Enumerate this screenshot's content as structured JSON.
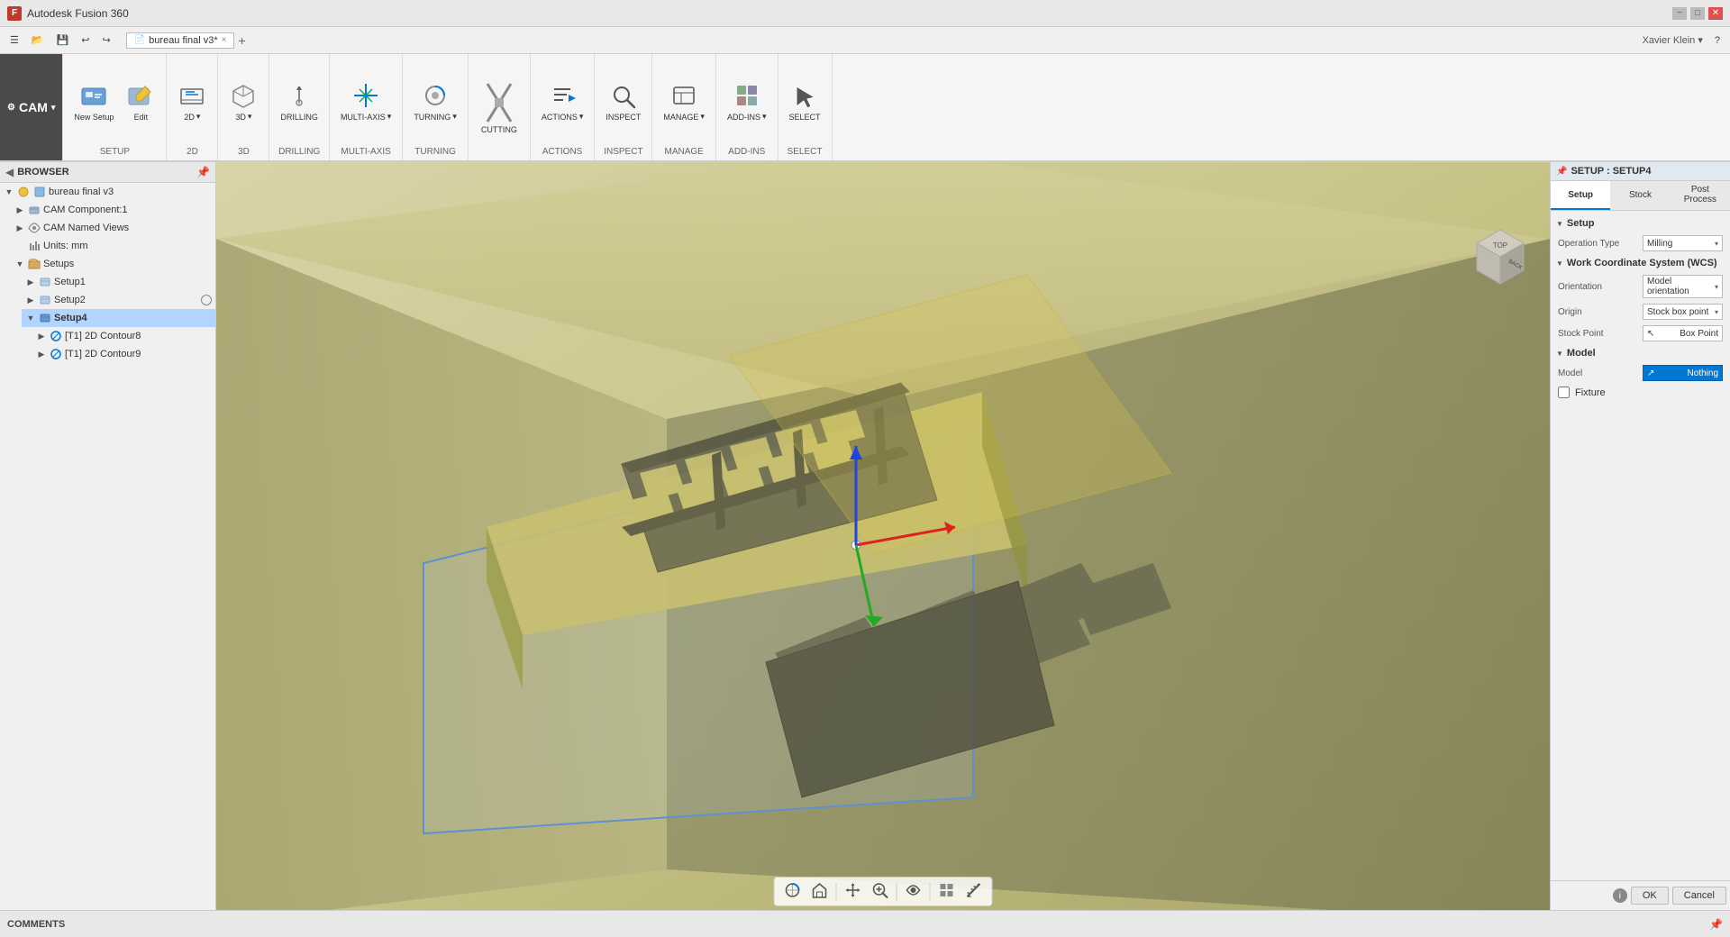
{
  "app": {
    "title": "Autodesk Fusion 360",
    "icon": "F"
  },
  "titlebar": {
    "title": "Autodesk Fusion 360",
    "minimize": "−",
    "maximize": "□",
    "close": "✕"
  },
  "quickaccess": {
    "save_label": "💾",
    "undo_label": "↩",
    "redo_label": "↪",
    "tab_label": "bureau final v3*",
    "tab_close": "×",
    "tab_add": "+"
  },
  "ribbon": {
    "cam_label": "CAM",
    "cam_arrow": "▾",
    "setup_label": "SETUP",
    "setup_arrow": "▾",
    "2d_label": "2D",
    "2d_arrow": "▾",
    "3d_label": "3D",
    "3d_arrow": "▾",
    "drilling_label": "DRILLING",
    "multi_axis_label": "MULTI-AXIS",
    "multi_axis_arrow": "▾",
    "turning_label": "TURNING",
    "turning_arrow": "▾",
    "cutting_label": "CUTTING",
    "actions_label": "ACTIONS",
    "actions_arrow": "▾",
    "inspect_label": "INSPECT",
    "manage_label": "MANAGE",
    "manage_arrow": "▾",
    "addins_label": "ADD-INS",
    "addins_arrow": "▾",
    "select_label": "SELECT"
  },
  "browser": {
    "header": "BROWSER",
    "items": [
      {
        "id": "root",
        "label": "bureau final v3",
        "indent": 0,
        "expanded": true,
        "icon": "📄"
      },
      {
        "id": "cam-component",
        "label": "CAM Component:1",
        "indent": 1,
        "expanded": false,
        "icon": "⚙"
      },
      {
        "id": "cam-named-views",
        "label": "CAM Named Views",
        "indent": 1,
        "expanded": false,
        "icon": "👁"
      },
      {
        "id": "units",
        "label": "Units: mm",
        "indent": 1,
        "expanded": false,
        "icon": "📏"
      },
      {
        "id": "setups",
        "label": "Setups",
        "indent": 1,
        "expanded": true,
        "icon": "📁"
      },
      {
        "id": "setup1",
        "label": "Setup1",
        "indent": 2,
        "expanded": false,
        "icon": "📦"
      },
      {
        "id": "setup2",
        "label": "Setup2",
        "indent": 2,
        "expanded": false,
        "icon": "📦"
      },
      {
        "id": "setup4",
        "label": "Setup4",
        "indent": 2,
        "expanded": true,
        "icon": "📦",
        "selected": true
      },
      {
        "id": "contour8",
        "label": "[T1] 2D Contour8",
        "indent": 3,
        "expanded": false,
        "icon": "🔧"
      },
      {
        "id": "contour9",
        "label": "[T1] 2D Contour9",
        "indent": 3,
        "expanded": false,
        "icon": "🔧"
      }
    ]
  },
  "setup_panel": {
    "title": "SETUP : SETUP4",
    "tabs": [
      {
        "id": "setup",
        "label": "Setup",
        "active": true
      },
      {
        "id": "stock",
        "label": "Stock"
      },
      {
        "id": "post",
        "label": "Post Process"
      }
    ],
    "sections": {
      "setup": {
        "label": "Setup",
        "operation_type_label": "Operation Type",
        "operation_type_value": "Milling"
      },
      "wcs": {
        "label": "Work Coordinate System (WCS)",
        "orientation_label": "Orientation",
        "orientation_value": "Model orientation",
        "origin_label": "Origin",
        "origin_value": "Stock box point",
        "stock_point_label": "Stock Point",
        "stock_point_value": "Box Point"
      },
      "model": {
        "label": "Model",
        "model_label": "Model",
        "model_value": "Nothing"
      },
      "fixture": {
        "label": "Fixture",
        "checked": false
      }
    },
    "actions": {
      "ok_label": "OK",
      "cancel_label": "Cancel"
    }
  },
  "viewport": {
    "bottom_toolbar": {
      "orbit": "⟳",
      "home": "⌂",
      "pan": "✋",
      "zoom": "🔍",
      "look_at": "👁",
      "display": "▦",
      "measure": "📐"
    }
  },
  "statusbar": {
    "comments_label": "COMMENTS",
    "pin_label": "📌"
  }
}
